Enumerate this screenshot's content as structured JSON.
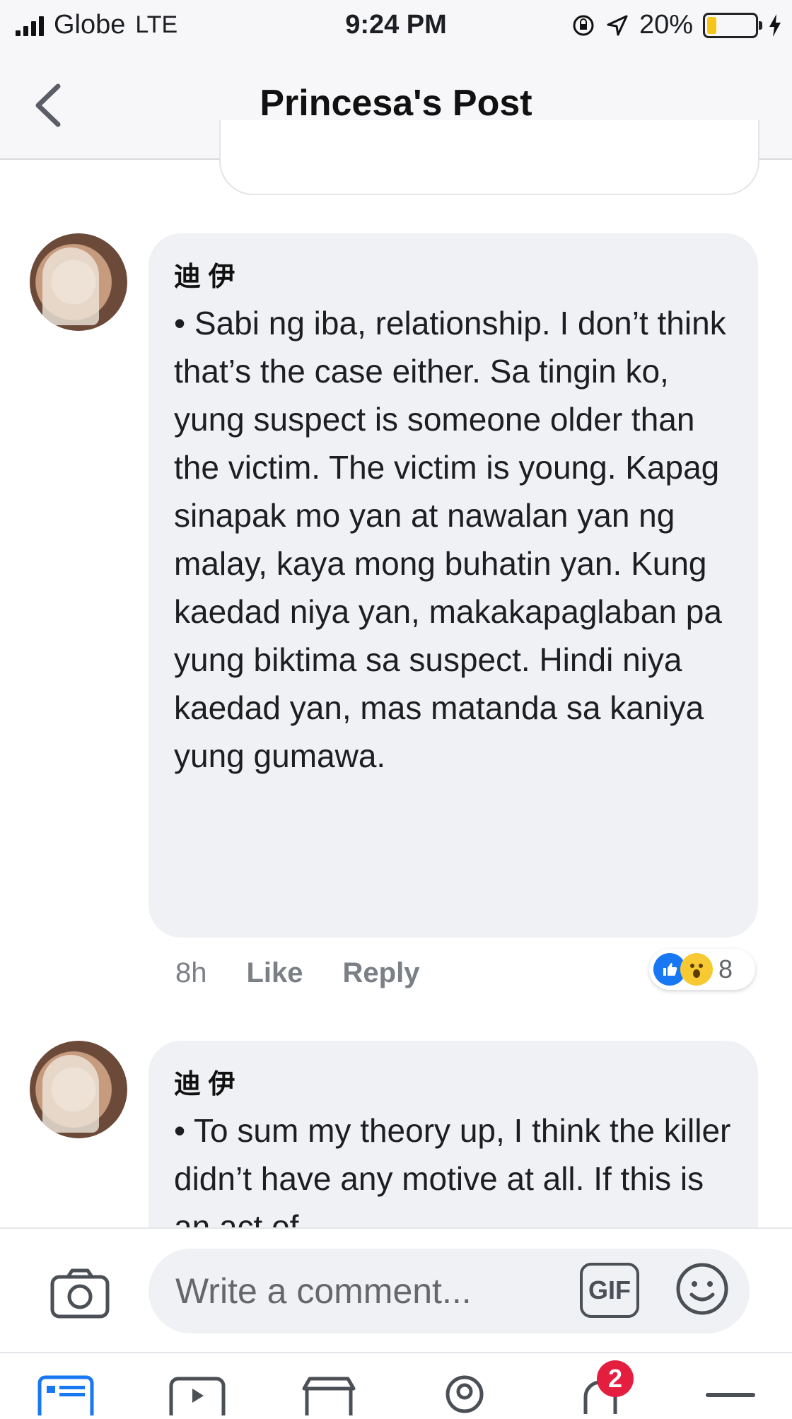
{
  "status_bar": {
    "carrier": "Globe",
    "network": "LTE",
    "time": "9:24 PM",
    "battery": "20%",
    "battery_level": 0.2
  },
  "header": {
    "title": "Princesa's Post"
  },
  "comments": [
    {
      "author": "迪 伊",
      "text": "• Sabi ng iba, relationship. I don’t think that’s the case either. Sa tingin ko, yung suspect is someone older than the victim. The victim is young. Kapag sinapak mo yan at nawalan yan ng malay, kaya mong buhatin yan. Kung kaedad niya yan, makakapaglaban pa yung biktima sa suspect. Hindi niya kaedad yan, mas matanda sa kaniya yung gumawa.",
      "time": "8h",
      "like_label": "Like",
      "reply_label": "Reply",
      "reaction_count": "8"
    },
    {
      "author": "迪 伊",
      "text": "• To sum my theory up, I think the killer didn’t have any motive at all. If this is an act of"
    }
  ],
  "composer": {
    "placeholder": "Write a comment...",
    "gif_label": "GIF"
  },
  "tabbar": {
    "notifications_badge": "2"
  },
  "colors": {
    "like_blue": "#1877f2",
    "badge_red": "#e41e3f",
    "bubble_gray": "#f0f1f4"
  }
}
